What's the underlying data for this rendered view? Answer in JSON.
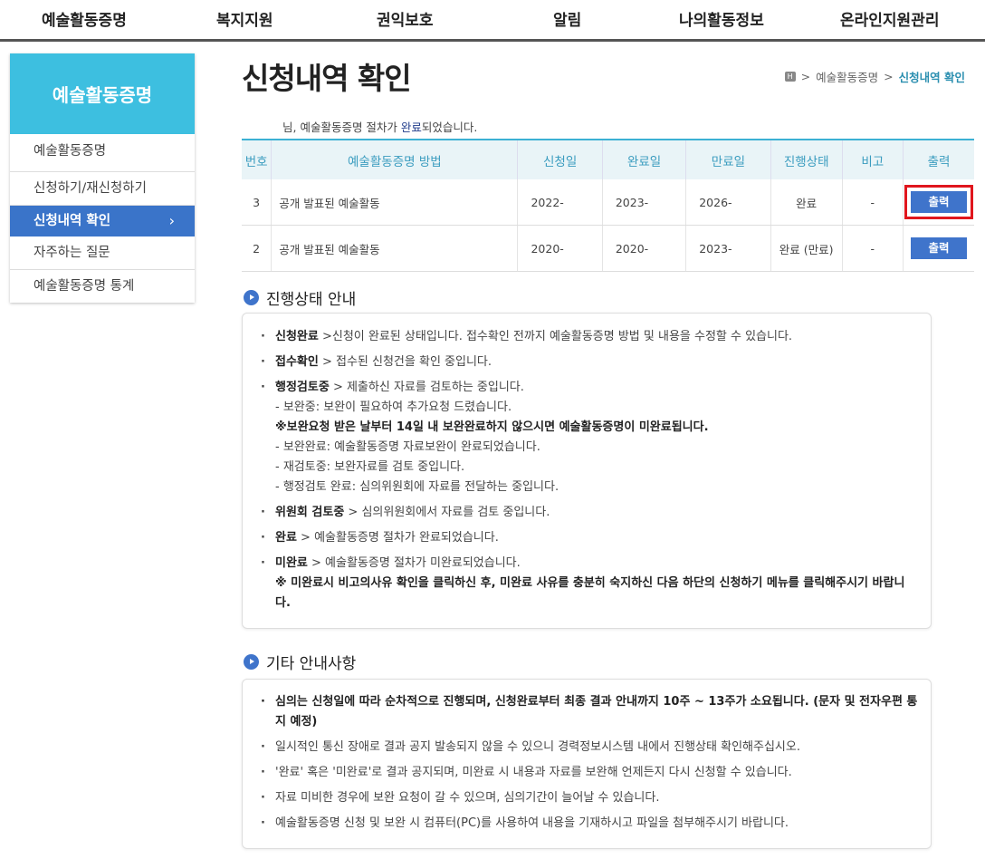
{
  "topnav": [
    "예술활동증명",
    "복지지원",
    "권익보호",
    "알림",
    "나의활동정보",
    "온라인지원관리"
  ],
  "sidebar": {
    "title": "예술활동증명",
    "items": [
      "예술활동증명",
      "신청하기/재신청하기",
      "신청내역 확인",
      "자주하는 질문",
      "예술활동증명 통계"
    ],
    "active_chevron": "›"
  },
  "page": {
    "title": "신청내역 확인"
  },
  "breadcrumb": {
    "home": "H",
    "sep": ">",
    "parent": "예술활동증명",
    "current": "신청내역 확인"
  },
  "notice": {
    "pre": "님, 예술활동증명 절차가 ",
    "highlight": "완료",
    "post": "되었습니다."
  },
  "table": {
    "headers": [
      "번호",
      "예술활동증명 방법",
      "신청일",
      "완료일",
      "만료일",
      "진행상태",
      "비고",
      "출력"
    ],
    "rows": [
      {
        "no": "3",
        "method": "공개 발표된 예술활동",
        "applied": "2022-",
        "completed": "2023-",
        "expires": "2026-",
        "status": "완료",
        "note": "-",
        "print": "출력"
      },
      {
        "no": "2",
        "method": "공개 발표된 예술활동",
        "applied": "2020-",
        "completed": "2020-",
        "expires": "2023-",
        "status": "완료 (만료)",
        "note": "-",
        "print": "출력"
      }
    ]
  },
  "status_guide": {
    "title": "진행상태 안내",
    "items": [
      {
        "term": "신청완료",
        "text": " >신청이 완료된 상태입니다. 접수확인 전까지 예술활동증명 방법 및 내용을 수정할 수 있습니다."
      },
      {
        "term": "접수확인",
        "text": " > 접수된 신청건을 확인 중입니다."
      },
      {
        "term": "행정검토중",
        "text": " > 제출하신 자료를 검토하는 중입니다.",
        "sub1": "- 보완중: 보완이 필요하여 추가요청 드렸습니다.",
        "warn": "※보완요청 받은 날부터 14일 내 보완완료하지 않으시면 예술활동증명이 미완료됩니다.",
        "sub2": "- 보완완료: 예술활동증명 자료보완이 완료되었습니다.",
        "sub3": "- 재검토중: 보완자료를 검토 중입니다.",
        "sub4": "- 행정검토 완료: 심의위원회에 자료를 전달하는 중입니다."
      },
      {
        "term": "위원회 검토중",
        "text": " > 심의위원회에서 자료를 검토 중입니다."
      },
      {
        "term": "완료",
        "text": " > 예술활동증명 절차가 완료되었습니다."
      },
      {
        "term": "미완료",
        "text": " > 예술활동증명 절차가 미완료되었습니다.",
        "warn": "※ 미완료시 비고의사유 확인을 클릭하신 후, 미완료 사유를 충분히 숙지하신 다음 하단의 신청하기 메뉴를 클릭해주시기 바랍니다."
      }
    ]
  },
  "other_guide": {
    "title": "기타 안내사항",
    "items": [
      "심의는 신청일에 따라 순차적으로 진행되며, 신청완료부터 최종 결과 안내까지 10주 ~ 13주가 소요됩니다. (문자 및 전자우편 통지 예정)",
      "일시적인 통신 장애로 결과 공지 발송되지 않을 수 있으니 경력정보시스템 내에서 진행상태 확인해주십시오.",
      "'완료' 혹은 '미완료'로 결과 공지되며, 미완료 시 내용과 자료를 보완해 언제든지 다시 신청할 수 있습니다.",
      "자료 미비한 경우에 보완 요청이 갈 수 있으며, 심의기간이 늘어날 수 있습니다.",
      "예술활동증명 신청 및 보완 시 컴퓨터(PC)를 사용하여 내용을 기재하시고 파일을 첨부해주시기 바랍니다."
    ]
  }
}
